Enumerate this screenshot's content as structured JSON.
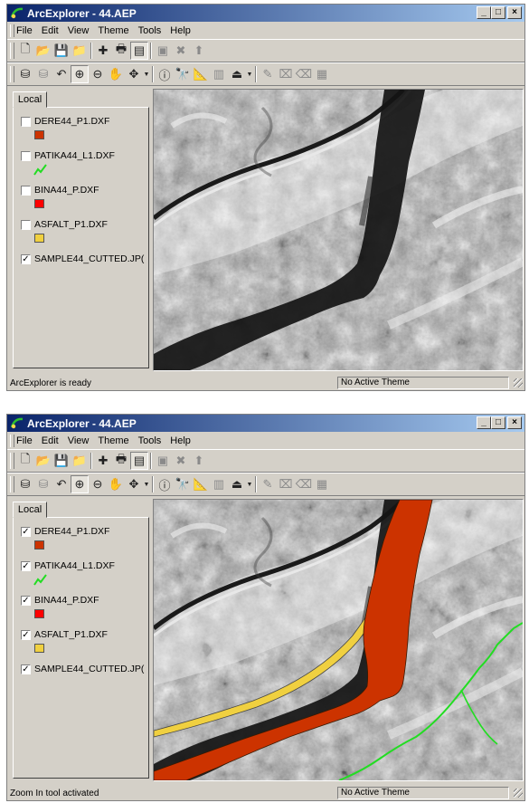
{
  "windows": [
    {
      "title": "ArcExplorer - 44.AEP",
      "menu": [
        "File",
        "Edit",
        "View",
        "Theme",
        "Tools",
        "Help"
      ],
      "tab_label": "Local",
      "layers": [
        {
          "name": "DERE44_P1.DXF",
          "checked": false,
          "symbol": "polygon",
          "color": "#cc3300"
        },
        {
          "name": "PATIKA44_L1.DXF",
          "checked": false,
          "symbol": "line",
          "color": "#22dd22"
        },
        {
          "name": "BINA44_P.DXF",
          "checked": false,
          "symbol": "polygon",
          "color": "#ff0000"
        },
        {
          "name": "ASFALT_P1.DXF",
          "checked": false,
          "symbol": "polygon",
          "color": "#f0d040"
        },
        {
          "name": "SAMPLE44_CUTTED.JP(",
          "checked": true,
          "symbol": "none",
          "color": ""
        }
      ],
      "status_text": "ArcExplorer is ready",
      "status_panel": "No Active Theme",
      "map_overlays_visible": false
    },
    {
      "title": "ArcExplorer - 44.AEP",
      "menu": [
        "File",
        "Edit",
        "View",
        "Theme",
        "Tools",
        "Help"
      ],
      "tab_label": "Local",
      "layers": [
        {
          "name": "DERE44_P1.DXF",
          "checked": true,
          "symbol": "polygon",
          "color": "#cc3300"
        },
        {
          "name": "PATIKA44_L1.DXF",
          "checked": true,
          "symbol": "line",
          "color": "#22dd22"
        },
        {
          "name": "BINA44_P.DXF",
          "checked": true,
          "symbol": "polygon",
          "color": "#ff0000"
        },
        {
          "name": "ASFALT_P1.DXF",
          "checked": true,
          "symbol": "polygon",
          "color": "#f0d040"
        },
        {
          "name": "SAMPLE44_CUTTED.JP(",
          "checked": true,
          "symbol": "none",
          "color": ""
        }
      ],
      "status_text": "Zoom In tool activated",
      "status_panel": "No Active Theme",
      "map_overlays_visible": true
    }
  ],
  "check_glyph": "✓",
  "window_buttons": {
    "minimize": "_",
    "maximize": "□",
    "close": "×"
  },
  "toolbar1": [
    {
      "name": "new-project-icon",
      "glyph": "🗋",
      "enabled": true
    },
    {
      "name": "open-project-icon",
      "glyph": "📂",
      "enabled": true
    },
    {
      "name": "save-project-icon",
      "glyph": "💾",
      "enabled": true
    },
    {
      "name": "open-project-folder-icon",
      "glyph": "📁",
      "enabled": true
    },
    {
      "sep": true
    },
    {
      "name": "add-theme-icon",
      "glyph": "✚",
      "enabled": true
    },
    {
      "name": "print-icon",
      "glyph": "🖶",
      "enabled": true
    },
    {
      "name": "legend-toggle-icon",
      "glyph": "▤",
      "enabled": true,
      "pressed": true
    },
    {
      "sep": true
    },
    {
      "name": "copy-map-icon",
      "glyph": "▣",
      "enabled": false
    },
    {
      "name": "delete-theme-icon",
      "glyph": "✖",
      "enabled": false
    },
    {
      "name": "theme-up-icon",
      "glyph": "⬆",
      "enabled": false
    }
  ],
  "toolbar2": [
    {
      "name": "theme-properties-icon",
      "glyph": "⛁",
      "enabled": true
    },
    {
      "name": "theme-properties-alt-icon",
      "glyph": "⛁",
      "enabled": false
    },
    {
      "name": "undo-extent-icon",
      "glyph": "↶",
      "enabled": true
    },
    {
      "name": "zoom-in-icon",
      "glyph": "⊕",
      "enabled": true,
      "pressed": true
    },
    {
      "name": "zoom-out-icon",
      "glyph": "⊖",
      "enabled": true
    },
    {
      "name": "pan-hand-icon",
      "glyph": "✋",
      "enabled": true
    },
    {
      "name": "pan-arrows-icon",
      "glyph": "✥",
      "enabled": true,
      "dropdown": true
    },
    {
      "sep": true
    },
    {
      "name": "identify-icon",
      "glyph": "ⓘ",
      "enabled": true
    },
    {
      "name": "find-icon",
      "glyph": "🔭",
      "enabled": true
    },
    {
      "name": "measure-icon",
      "glyph": "📐",
      "enabled": true
    },
    {
      "name": "query-builder-icon",
      "glyph": "▥",
      "enabled": false
    },
    {
      "name": "select-by-graphic-icon",
      "glyph": "⏏",
      "enabled": true,
      "dropdown": true
    },
    {
      "sep": true
    },
    {
      "name": "spatial-select-icon",
      "glyph": "✎",
      "enabled": false
    },
    {
      "name": "clear-selection-icon",
      "glyph": "⌧",
      "enabled": false
    },
    {
      "name": "eraser-icon",
      "glyph": "⌫",
      "enabled": false
    },
    {
      "name": "report-icon",
      "glyph": "▦",
      "enabled": false
    }
  ],
  "colors": {
    "titlebar_start": "#0a246a",
    "titlebar_end": "#a6caf0",
    "face": "#d4d0c8",
    "app_icon": "#2fbf2f"
  }
}
